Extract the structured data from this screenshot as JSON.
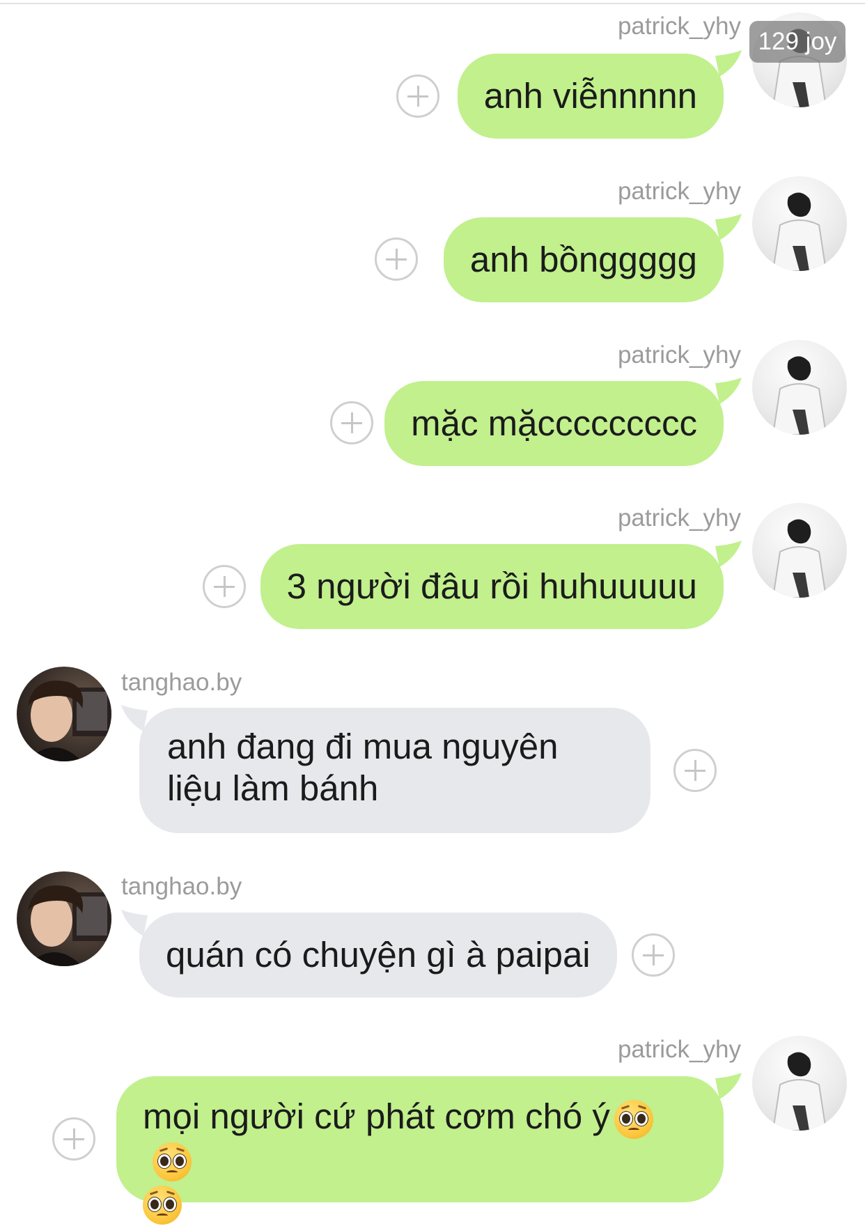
{
  "badge": {
    "text": "129 joy"
  },
  "icons": {
    "add": "plus-circle-icon",
    "emoji": "pleading-face-emoji-icon"
  },
  "colors": {
    "outgoing_bubble": "#c1f08d",
    "incoming_bubble": "#e6e8ec",
    "username": "#9b9b9b",
    "text": "#1b1b1b"
  },
  "messages": [
    {
      "sender": "patrick_yhy",
      "side": "right",
      "text": "anh viễnnnnn"
    },
    {
      "sender": "patrick_yhy",
      "side": "right",
      "text": "anh bồnggggg"
    },
    {
      "sender": "patrick_yhy",
      "side": "right",
      "text": "mặc mặccccccccc"
    },
    {
      "sender": "patrick_yhy",
      "side": "right",
      "text": "3 người đâu rồi huhuuuuu"
    },
    {
      "sender": "tanghao.by",
      "side": "left",
      "text": "anh đang đi mua nguyên liệu làm bánh"
    },
    {
      "sender": "tanghao.by",
      "side": "left",
      "text": "quán có chuyện gì à paipai"
    },
    {
      "sender": "patrick_yhy",
      "side": "right",
      "text": "mọi người cứ phát cơm chó ý"
    }
  ]
}
